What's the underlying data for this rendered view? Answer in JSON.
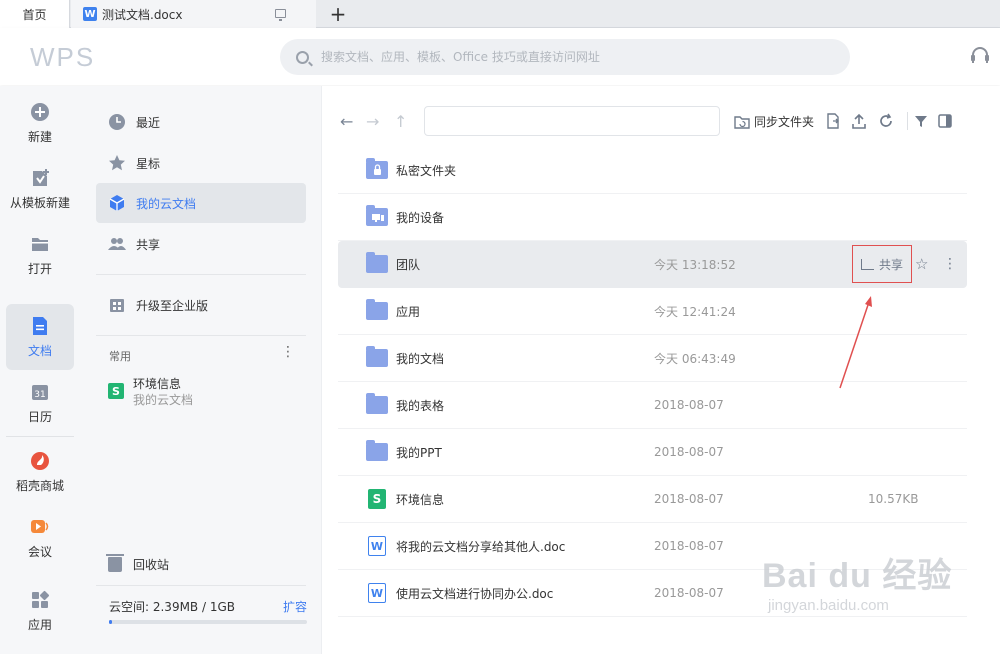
{
  "tabs": {
    "home": "首页",
    "doc": "测试文档.docx",
    "doc_icon": "W",
    "add": "+"
  },
  "header": {
    "logo": "WPS",
    "search_placeholder": "搜索文档、应用、模板、Office 技巧或直接访问网址"
  },
  "leftnav": [
    {
      "label": "新建",
      "icon": "plus-circle-icon"
    },
    {
      "label": "从模板新建",
      "icon": "template-icon"
    },
    {
      "label": "打开",
      "icon": "folder-open-icon"
    },
    {
      "label": "文档",
      "icon": "document-icon"
    },
    {
      "label": "日历",
      "icon": "calendar-icon",
      "glyph": "31"
    },
    {
      "label": "稻壳商城",
      "icon": "docer-mall-icon"
    },
    {
      "label": "会议",
      "icon": "meeting-icon"
    },
    {
      "label": "应用",
      "icon": "apps-icon"
    }
  ],
  "sidebar": {
    "recent": "最近",
    "starred": "星标",
    "cloud": "我的云文档",
    "shared": "共享",
    "upgrade": "升级至企业版",
    "common": "常用",
    "common_more": "⋮",
    "recent_file": {
      "name": "环境信息",
      "location": "我的云文档",
      "icon": "S"
    },
    "trash": "回收站",
    "storage_label": "云空间: 2.39MB / 1GB",
    "expand": "扩容",
    "storage_used": 0.0023
  },
  "toolbar": {
    "back": "←",
    "forward": "→",
    "up": "↑",
    "sync": "同步文件夹"
  },
  "files": [
    {
      "name": "私密文件夹",
      "type": "folder-lock",
      "time": "",
      "size": ""
    },
    {
      "name": "我的设备",
      "type": "folder-device",
      "time": "",
      "size": ""
    },
    {
      "name": "团队",
      "type": "folder",
      "time": "今天 13:18:52",
      "size": "",
      "highlighted": true
    },
    {
      "name": "应用",
      "type": "folder",
      "time": "今天 12:41:24",
      "size": ""
    },
    {
      "name": "我的文档",
      "type": "folder",
      "time": "今天 06:43:49",
      "size": ""
    },
    {
      "name": "我的表格",
      "type": "folder",
      "time": "2018-08-07",
      "size": ""
    },
    {
      "name": "我的PPT",
      "type": "folder",
      "time": "2018-08-07",
      "size": ""
    },
    {
      "name": "环境信息",
      "type": "sheet",
      "time": "2018-08-07",
      "size": "10.57KB"
    },
    {
      "name": "将我的云文档分享给其他人.doc",
      "type": "doc",
      "time": "2018-08-07",
      "size": ""
    },
    {
      "name": "使用云文档进行协同办公.doc",
      "type": "doc",
      "time": "2018-08-07",
      "size": ""
    }
  ],
  "row_actions": {
    "share": "共享",
    "star": "☆",
    "more": "⋮"
  },
  "watermark": {
    "line1": "Bai du 经验",
    "line2": "jingyan.baidu.com"
  },
  "colors": {
    "accent": "#3f7cf0",
    "folder": "#8aa4e8",
    "sheet": "#22b573",
    "doc": "#3f82ee",
    "annotation": "#e05050"
  }
}
